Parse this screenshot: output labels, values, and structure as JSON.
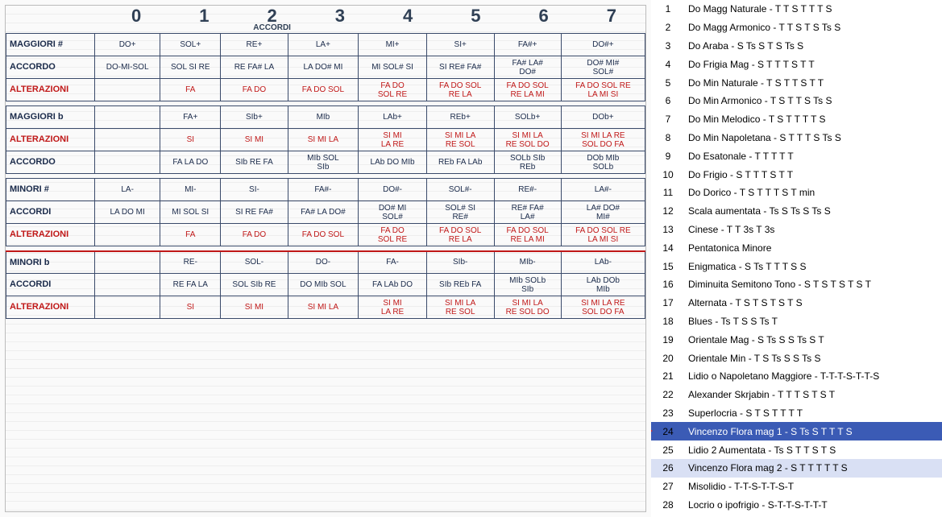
{
  "sheet": {
    "col_headers": [
      "0",
      "1",
      "2",
      "3",
      "4",
      "5",
      "6",
      "7"
    ],
    "col_sub": "ACCORDI",
    "groups": [
      {
        "rows": [
          {
            "label": "MAGGIORI #",
            "cells": [
              "DO+",
              "SOL+",
              "RE+",
              "LA+",
              "MI+",
              "SI+",
              "FA#+",
              "DO#+"
            ]
          },
          {
            "label": "ACCORDO",
            "cells": [
              "DO-MI-SOL",
              "SOL SI RE",
              "RE FA# LA",
              "LA DO# MI",
              "MI SOL# SI",
              "SI RE# FA#",
              "FA# LA# DO#",
              "DO# MI# SOL#"
            ]
          },
          {
            "label": "ALTERAZIONI",
            "alt": true,
            "cells": [
              "",
              "FA",
              "FA DO",
              "FA DO SOL",
              "FA DO SOL RE",
              "FA DO SOL RE LA",
              "FA DO SOL RE LA MI",
              "FA DO SOL RE LA MI SI"
            ]
          }
        ]
      },
      {
        "rows": [
          {
            "label": "MAGGIORI b",
            "cells": [
              "",
              "FA+",
              "SIb+",
              "MIb",
              "LAb+",
              "REb+",
              "SOLb+",
              "DOb+"
            ]
          },
          {
            "label": "ALTERAZIONI",
            "alt": true,
            "cells": [
              "",
              "SI",
              "SI MI",
              "SI MI LA",
              "SI MI LA RE",
              "SI MI LA RE SOL",
              "SI MI LA RE SOL DO",
              "SI MI LA RE SOL DO FA"
            ]
          },
          {
            "label": "ACCORDO",
            "cells": [
              "",
              "FA LA DO",
              "SIb RE FA",
              "MIb SOL SIb",
              "LAb DO MIb",
              "REb FA LAb",
              "SOLb SIb REb",
              "DOb MIb SOLb"
            ]
          }
        ]
      },
      {
        "rows": [
          {
            "label": "MINORI #",
            "cells": [
              "LA-",
              "MI-",
              "SI-",
              "FA#-",
              "DO#-",
              "SOL#-",
              "RE#-",
              "LA#-"
            ]
          },
          {
            "label": "ACCORDI",
            "cells": [
              "LA DO MI",
              "MI SOL SI",
              "SI RE FA#",
              "FA# LA DO#",
              "DO# MI SOL#",
              "SOL# SI RE#",
              "RE# FA# LA#",
              "LA# DO# MI#"
            ]
          },
          {
            "label": "ALTERAZIONI",
            "alt": true,
            "cells": [
              "",
              "FA",
              "FA DO",
              "FA DO SOL",
              "FA DO SOL RE",
              "FA DO SOL RE LA",
              "FA DO SOL RE LA MI",
              "FA DO SOL RE LA MI SI"
            ]
          }
        ]
      },
      {
        "rows": [
          {
            "label": "MINORI b",
            "section": true,
            "cells": [
              "",
              "RE-",
              "SOL-",
              "DO-",
              "FA-",
              "SIb-",
              "MIb-",
              "LAb-"
            ]
          },
          {
            "label": "ACCORDI",
            "cells": [
              "",
              "RE FA LA",
              "SOL SIb RE",
              "DO MIb SOL",
              "FA LAb DO",
              "SIb REb FA",
              "MIb SOLb SIb",
              "LAb DOb MIb"
            ]
          },
          {
            "label": "ALTERAZIONI",
            "alt": true,
            "cells": [
              "",
              "SI",
              "SI MI",
              "SI MI LA",
              "SI MI LA RE",
              "SI MI LA RE SOL",
              "SI MI LA RE SOL DO",
              "SI MI LA RE SOL DO FA"
            ]
          }
        ]
      }
    ]
  },
  "list": {
    "items": [
      {
        "n": "1",
        "txt": "Do Magg Naturale - T T S T T T S"
      },
      {
        "n": "2",
        "txt": "Do Magg Armonico - T T S T S Ts S"
      },
      {
        "n": "3",
        "txt": "Do Araba - S Ts S T S Ts S"
      },
      {
        "n": "4",
        "txt": "Do Frigia Mag - S T T T S T T"
      },
      {
        "n": "5",
        "txt": "Do Min Naturale - T S T T S T T"
      },
      {
        "n": "6",
        "txt": "Do Min Armonico - T S T T S Ts S"
      },
      {
        "n": "7",
        "txt": "Do Min Melodico - T S T T T T S"
      },
      {
        "n": "8",
        "txt": "Do Min Napoletana - S T T T S Ts S"
      },
      {
        "n": "9",
        "txt": "Do Esatonale - T T T T T"
      },
      {
        "n": "10",
        "txt": "Do Frigio - S T T T S T T"
      },
      {
        "n": "11",
        "txt": "Do Dorico - T S T T T S T min"
      },
      {
        "n": "12",
        "txt": "Scala aumentata - Ts S Ts S Ts S"
      },
      {
        "n": "13",
        "txt": "Cinese - T T 3s T 3s"
      },
      {
        "n": "14",
        "txt": "Pentatonica Minore"
      },
      {
        "n": "15",
        "txt": "Enigmatica - S Ts T T T S S"
      },
      {
        "n": "16",
        "txt": "Diminuita Semitono Tono - S T S T S T S T"
      },
      {
        "n": "17",
        "txt": "Alternata - T S T S T S T S"
      },
      {
        "n": "18",
        "txt": "Blues - Ts T S S Ts T"
      },
      {
        "n": "19",
        "txt": "Orientale Mag - S Ts S S Ts S T"
      },
      {
        "n": "20",
        "txt": "Orientale Min -  T S Ts S S Ts S"
      },
      {
        "n": "21",
        "txt": "Lidio o Napoletano Maggiore - T-T-T-S-T-T-S"
      },
      {
        "n": "22",
        "txt": "Alexander Skrjabin - T T T S T S T"
      },
      {
        "n": "23",
        "txt": "Superlocria - S T S T T T T"
      },
      {
        "n": "24",
        "txt": "Vincenzo Flora mag 1 - S Ts S T T T S",
        "selected": true,
        "arrow": true
      },
      {
        "n": "25",
        "txt": "Lidio 2 Aumentata - Ts S T T S T S"
      },
      {
        "n": "26",
        "txt": "Vincenzo Flora mag 2 - S T T T T T S",
        "soft": true
      },
      {
        "n": "27",
        "txt": "Misolidio - T-T-S-T-T-S-T"
      },
      {
        "n": "28",
        "txt": "Locrio o ipofrigio - S-T-T-S-T-T-T"
      }
    ]
  }
}
